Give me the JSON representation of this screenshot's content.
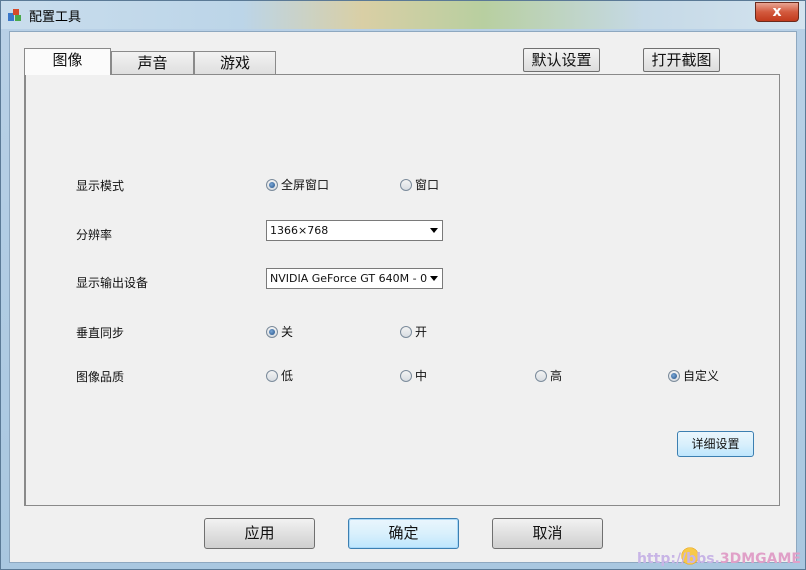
{
  "window": {
    "title": "配置工具",
    "close_label": "x"
  },
  "tabs": [
    {
      "label": "图像",
      "active": true
    },
    {
      "label": "声音",
      "active": false
    },
    {
      "label": "游戏",
      "active": false
    }
  ],
  "toolbar": {
    "default_settings_label": "默认设置",
    "open_screenshot_label": "打开截图"
  },
  "settings": {
    "display_mode": {
      "label": "显示模式",
      "options": [
        "全屏窗口",
        "窗口"
      ],
      "selected": "全屏窗口"
    },
    "resolution": {
      "label": "分辨率",
      "value": "1366×768"
    },
    "display_device": {
      "label": "显示输出设备",
      "value": "NVIDIA GeForce GT 640M  - 0"
    },
    "vsync": {
      "label": "垂直同步",
      "options": [
        "关",
        "开"
      ],
      "selected": "关"
    },
    "image_quality": {
      "label": "图像品质",
      "options": [
        "低",
        "中",
        "高",
        "自定义"
      ],
      "selected": "自定义"
    },
    "detail_button_label": "详细设置"
  },
  "footer": {
    "apply_label": "应用",
    "ok_label": "确定",
    "cancel_label": "取消"
  },
  "watermark": {
    "url_text": "http://bbs.",
    "brand_text": "3DMGAME"
  },
  "colors": {
    "accent_border": "#3c7fb1",
    "close_button": "#c23a1c"
  }
}
